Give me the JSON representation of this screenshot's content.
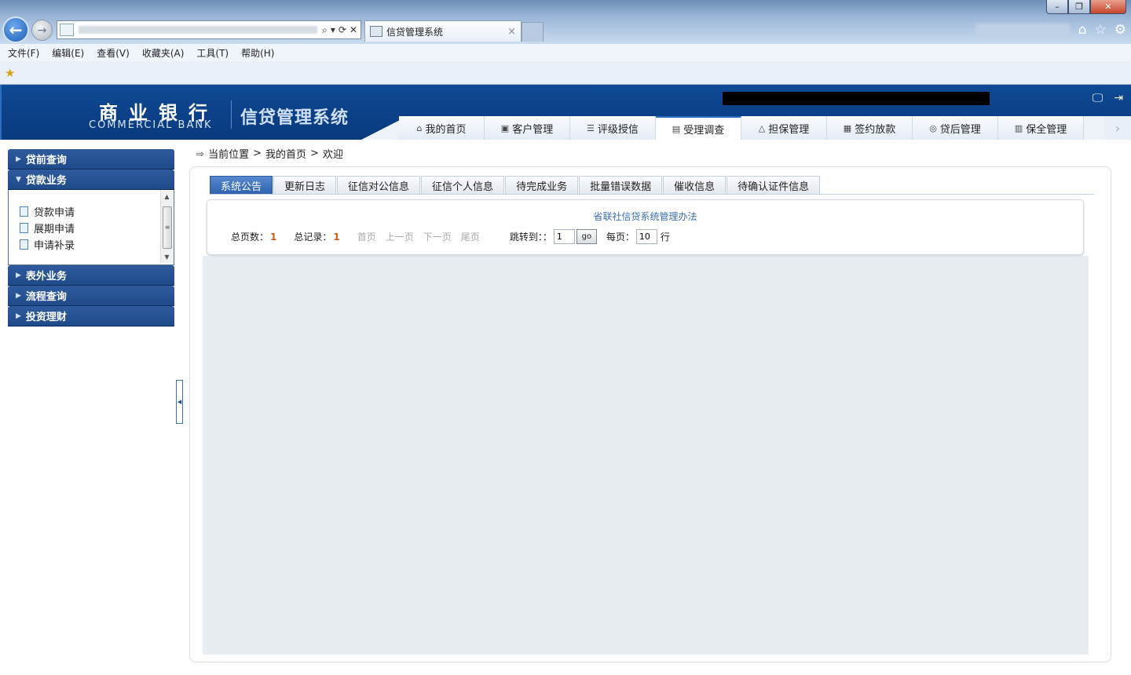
{
  "browser": {
    "tab_title": "信贷管理系统",
    "tab_close": "×",
    "back_icon": "←",
    "forward_icon": "→",
    "address_tools": [
      "⌕",
      "▾",
      "⟳",
      "✕"
    ],
    "window_buttons": {
      "minimize": "–",
      "maximize": "❐",
      "close": "✕"
    },
    "right_icons": [
      "⌂",
      "☆",
      "⚙"
    ],
    "menu": [
      "文件(F)",
      "编辑(E)",
      "查看(V)",
      "收藏夹(A)",
      "工具(T)",
      "帮助(H)"
    ]
  },
  "header": {
    "logo_cn": "商业银行",
    "logo_en": "COMMERCIAL BANK",
    "system_title": "信贷管理系统",
    "nav": [
      {
        "icon": "⌂",
        "label": "我的首页"
      },
      {
        "icon": "▣",
        "label": "客户管理"
      },
      {
        "icon": "☰",
        "label": "评级授信"
      },
      {
        "icon": "▤",
        "label": "受理调查"
      },
      {
        "icon": "△",
        "label": "担保管理"
      },
      {
        "icon": "▦",
        "label": "签约放款"
      },
      {
        "icon": "◎",
        "label": "贷后管理"
      },
      {
        "icon": "▥",
        "label": "保全管理"
      }
    ],
    "active_nav_index": 3
  },
  "sidebar": {
    "sections": [
      {
        "label": "贷前查询",
        "expanded": false
      },
      {
        "label": "贷款业务",
        "expanded": true,
        "items": [
          "贷款申请",
          "展期申请",
          "申请补录"
        ]
      },
      {
        "label": "表外业务",
        "expanded": false
      },
      {
        "label": "流程查询",
        "expanded": false
      },
      {
        "label": "投资理财",
        "expanded": false
      }
    ]
  },
  "breadcrumb": {
    "label": "当前位置",
    "path": [
      "我的首页",
      "欢迎"
    ],
    "separator": ">"
  },
  "subtabs": [
    "系统公告",
    "更新日志",
    "征信对公信息",
    "征信个人信息",
    "待完成业务",
    "批量错误数据",
    "催收信息",
    "待确认证件信息"
  ],
  "active_subtab_index": 0,
  "notice": {
    "title": "省联社信贷系统管理办法",
    "total_pages_label": "总页数：",
    "total_pages": "1",
    "total_records_label": "总记录：",
    "total_records": "1",
    "first": "首页",
    "prev": "上一页",
    "next": "下一页",
    "last": "尾页",
    "jump_label": "跳转到：：",
    "jump_value": "1",
    "go_label": "go",
    "per_page_label": "每页：",
    "per_page_value": "10",
    "row_label": "行"
  },
  "colors": {
    "header_blue": "#0b3f86",
    "active_tab": "#2f62b0",
    "count_orange": "#d35a10",
    "link_blue": "#3b6fb2"
  }
}
